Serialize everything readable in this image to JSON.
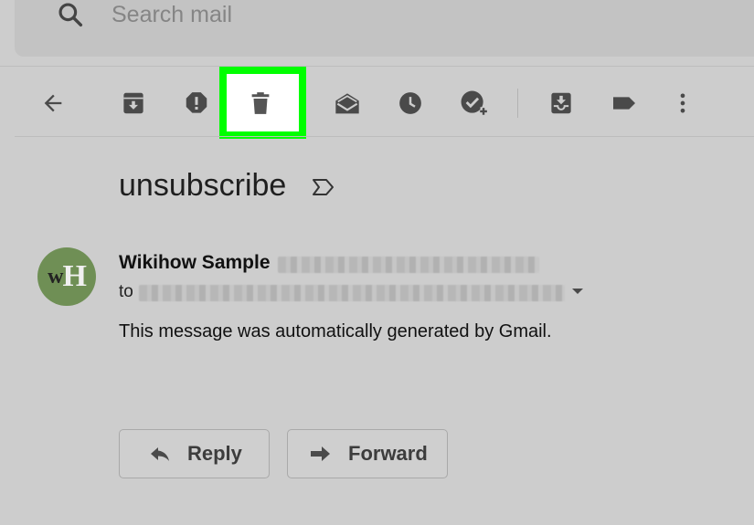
{
  "search": {
    "placeholder": "Search mail"
  },
  "toolbar": {
    "items": [
      "back",
      "archive",
      "report-spam",
      "delete",
      "mark-unread",
      "snooze",
      "add-to-tasks",
      "move-to",
      "labels",
      "more"
    ],
    "highlighted": "delete",
    "highlight_color": "#00ff00"
  },
  "message": {
    "subject": "unsubscribe",
    "sender_name": "Wikihow Sample",
    "to_label": "to",
    "body": "This message was automatically generated by Gmail.",
    "avatar_letters": {
      "first": "w",
      "second": "H"
    },
    "avatar_color": "#6f8f55"
  },
  "actions": {
    "reply_label": "Reply",
    "forward_label": "Forward"
  }
}
